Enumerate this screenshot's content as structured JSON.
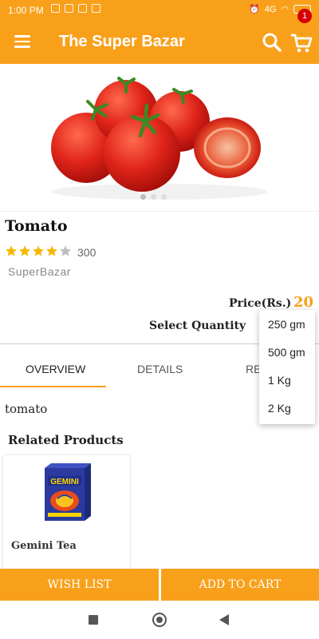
{
  "status_bar": {
    "time": "1:00 PM",
    "network": "4G"
  },
  "app_bar": {
    "title": "The Super Bazar",
    "cart_count": "1",
    "menu_icon": "hamburger-menu-icon",
    "search_icon": "search-icon",
    "cart_icon": "cart-icon"
  },
  "colors": {
    "primary": "#f9a01b",
    "badge": "#d50000",
    "star": "#f5b800"
  },
  "carousel": {
    "pages": 3,
    "active": 1
  },
  "product": {
    "name": "Tomato",
    "rating": 4,
    "rating_max": 5,
    "rating_count": "300",
    "seller": "SuperBazar",
    "price_label": "Price(Rs.)",
    "price": "20",
    "select_quantity_label": "Select Quantity"
  },
  "quantity_dropdown": {
    "options": [
      "250 gm",
      "500 gm",
      "1 Kg",
      "2 Kg"
    ]
  },
  "tabs": [
    {
      "label": "OVERVIEW",
      "active": true
    },
    {
      "label": "DETAILS",
      "active": false
    },
    {
      "label": "REVIEWS",
      "active": false
    }
  ],
  "overview": {
    "text": "tomato"
  },
  "related": {
    "title": "Related Products",
    "items": [
      {
        "name": "Gemini Tea",
        "brand_text": "GEMINI"
      }
    ]
  },
  "buttons": {
    "wish_list": "WISH LIST",
    "add_to_cart": "ADD TO CART"
  }
}
